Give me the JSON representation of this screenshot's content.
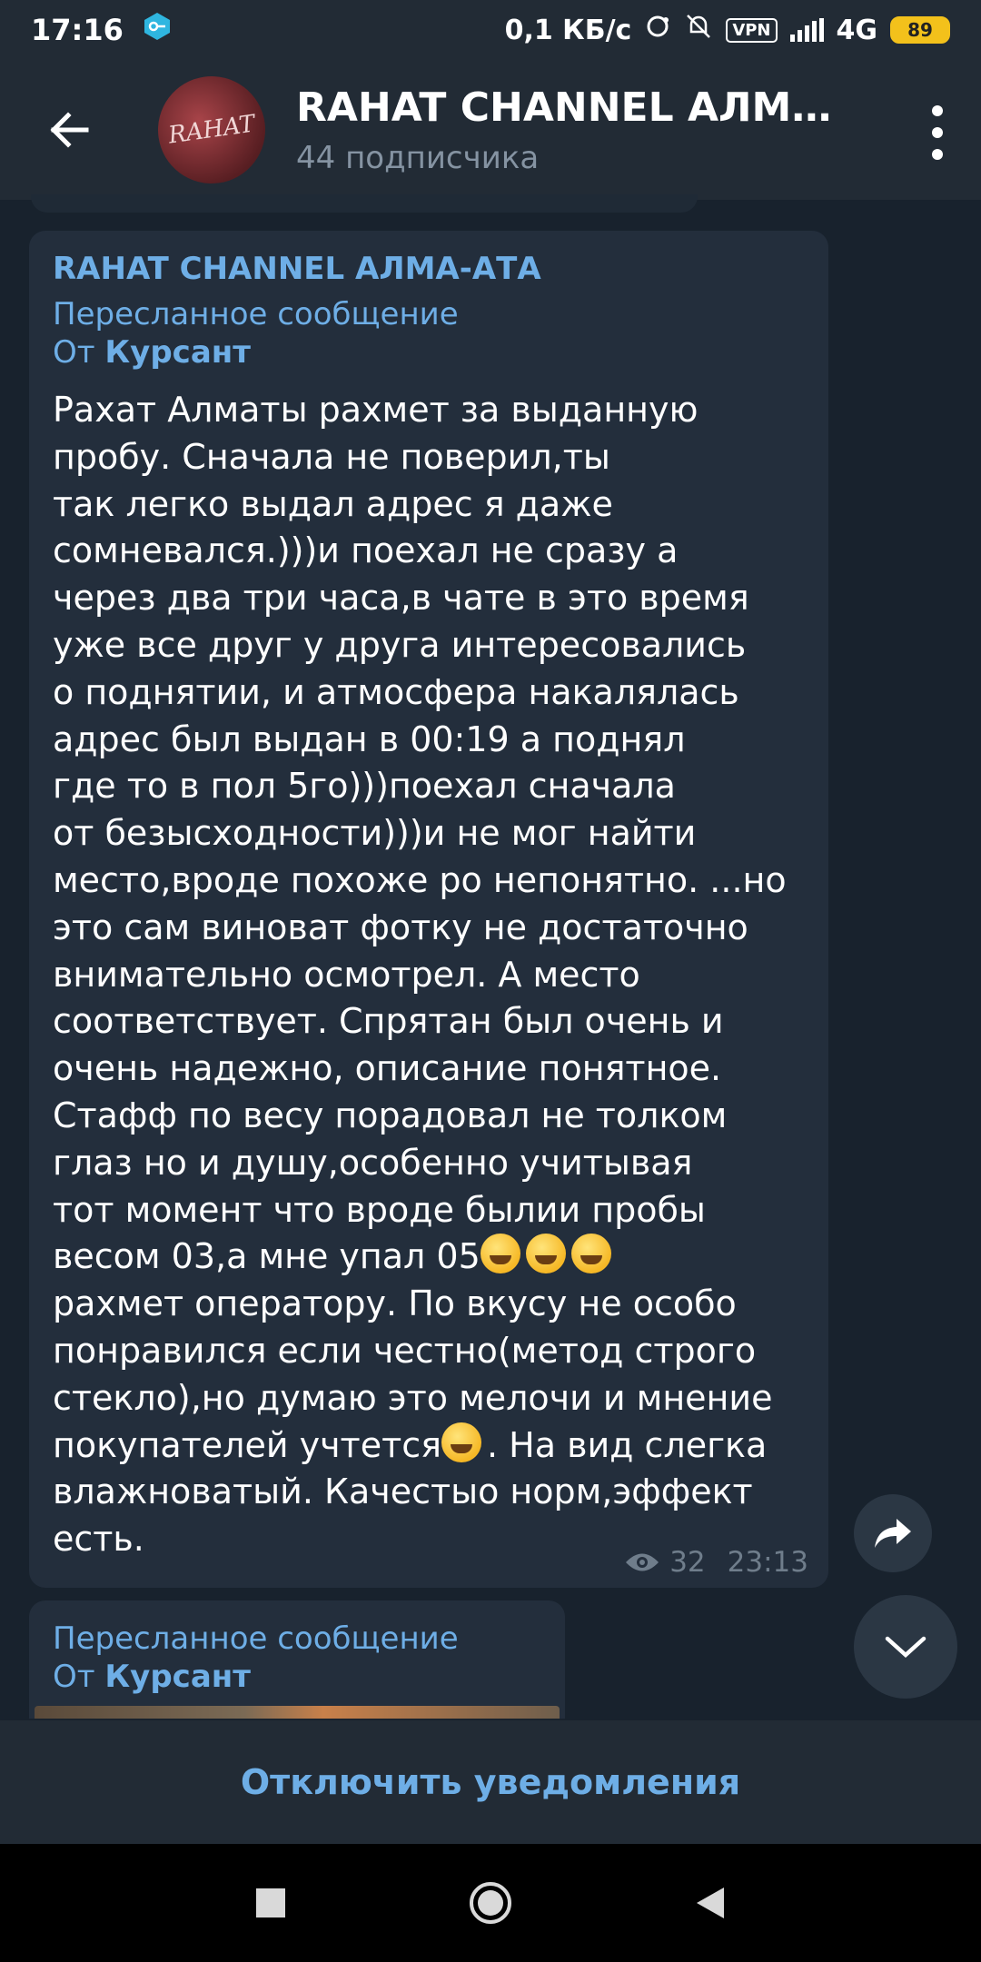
{
  "status_bar": {
    "time": "17:16",
    "net_speed": "0,1 КБ/с",
    "vpn": "VPN",
    "network": "4G",
    "battery": "89"
  },
  "header": {
    "title": "RAHAT CHANNEL АЛМА-...",
    "subtitle": "44 подписчика",
    "avatar_text": "RAHAT"
  },
  "message": {
    "channel": "RAHAT CHANNEL АЛМА-АТА",
    "forwarded_label": "Пересланное сообщение",
    "from_prefix": "От ",
    "from_name": "Курсант",
    "text_part1": "Рахат Алматы рахмет за выданную\nпробу. Сначала не поверил,ты\nтак легко выдал адрес я даже\nсомневался.)))и поехал не сразу а\nчерез два три часа,в чате в это время\nуже все друг у друга интересовались\nо поднятии, и атмосфера накалялась\nадрес был выдан в 00:19 а поднял\nгде то в пол 5го)))поехал сначала\nот безысходности)))и не мог найти\nместо,вроде похоже ро непонятно. ...но\nэто сам виноват фотку не достаточно\nвнимательно осмотрел.  А место\nсоответствует. Спрятан был очень и\nочень надежно, описание понятное.\nСтафф по весу  порадовал не толком\nглаз но и душу,особенно учитывая\nтот момент что вроде былии пробы\nвесом 03,а мне упал 05",
    "text_part2": "рахмет оператору. По вкусу не  особо\nпонравился если честно(метод строго\nстекло),но думаю это мелочи и мнение\nпокупателей учтется",
    "text_part3": ". На вид слегка\nвлажноватый. Качестыо норм,эффект\nесть.",
    "views": "32",
    "time": "23:13"
  },
  "message2": {
    "forwarded_label": "Пересланное сообщение",
    "from_prefix": "От ",
    "from_name": "Курсант"
  },
  "bottom_bar": {
    "action_label": "Отключить уведомления"
  },
  "icons": {
    "back": "arrow-left-icon",
    "menu": "more-vertical-icon",
    "share": "share-icon",
    "scroll": "chevron-down-icon",
    "views": "eye-icon",
    "emoji": "grinning-face-icon",
    "wink": "winking-face-icon"
  },
  "colors": {
    "accent": "#6eaee6",
    "background": "#18222d",
    "bubble": "#232e3c",
    "header": "#222b35"
  }
}
